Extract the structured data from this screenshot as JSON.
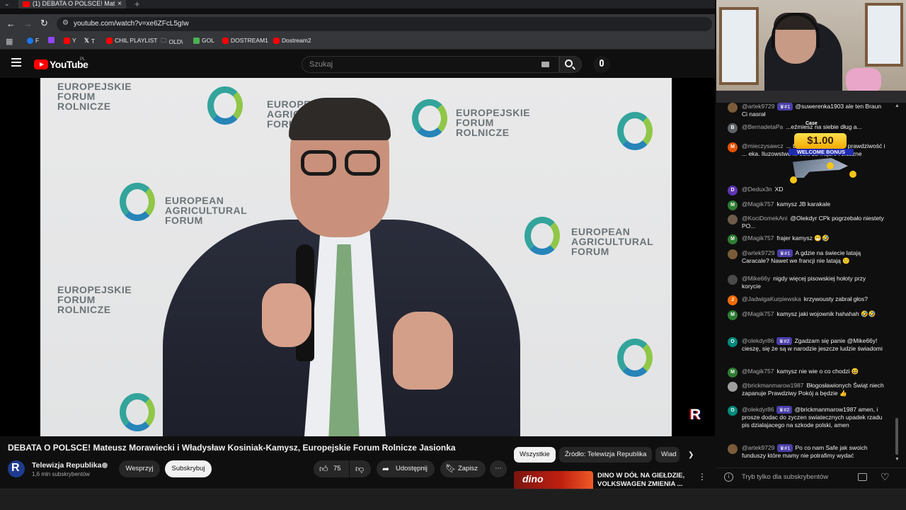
{
  "browser": {
    "tab_title": "(1) DEBATA O POLSCE! Mat",
    "url": "youtube.com/watch?v=xe6ZFcL5gIw",
    "bookmarks": [
      {
        "label": "F",
        "color": "#1877f2"
      },
      {
        "label": "",
        "color": "#9146ff"
      },
      {
        "label": "Y",
        "color": "#ff0000"
      },
      {
        "label": "T",
        "color": "#ffffff"
      },
      {
        "label": "CHIL PLAYLIST",
        "color": "#ff0000"
      },
      {
        "label": "OLD\\",
        "color": "#bdc1c6"
      },
      {
        "label": "GOL",
        "color": "#4caf50"
      },
      {
        "label": "DOSTREAM1",
        "color": "#ff0000"
      },
      {
        "label": "Dostream2",
        "color": "#ff0000"
      }
    ]
  },
  "youtube": {
    "logo_text": "YouTube",
    "region": "PL",
    "search_placeholder": "Szukaj"
  },
  "video": {
    "backdrop_texts": [
      {
        "text": "EUROPEJSKIE\nFORUM\nROLNICZE"
      },
      {
        "text": "EUROPEAN\nAGRICULTURAL\nFORUM"
      }
    ],
    "channel_bug": "R",
    "title": "DEBATA O POLSCE! Mateusz Morawiecki i Władysław Kosiniak-Kamysz, Europejskie Forum Rolnicze Jasionka",
    "channel_name": "Telewizja Republika",
    "channel_avatar": "R",
    "subscribers": "1,6 mln subskrybentów",
    "support_label": "Wesprzyj",
    "subscribe_label": "Subskrybuj",
    "likes": "75",
    "share_label": "Udostępnij",
    "save_label": "Zapisz"
  },
  "suggestions": {
    "chips": [
      "Wszystkie",
      "Źródło: Telewizja Republika",
      "Wiad"
    ],
    "thumb_text": "dino",
    "item_title": "DINO W DÓŁ NA GIEŁDZIE, VOLKSWAGEN ZMIENIA ..."
  },
  "chat": {
    "messages": [
      {
        "avatar": "",
        "avatar_color": "#7a5c3a",
        "author": "@artek9729",
        "badge": "♛#1",
        "text": "@suwerenka1903 ale ten Braun Ci nasrał"
      },
      {
        "avatar": "B",
        "avatar_color": "#5f6368",
        "author": "@BernadetaPa",
        "badge": "",
        "text": "...eźmiesz na siebie dług a..."
      },
      {
        "avatar": "M",
        "avatar_color": "#e65100",
        "author": "@mieczysawcz",
        "badge": "",
        "text": "... by powiedział Kos... prawdziwość i ... eka. Iluzowstwo ... ecki za mądre i słuszne"
      },
      {
        "avatar": "D",
        "avatar_color": "#5e35b1",
        "author": "@Dedux3n",
        "badge": "",
        "text": "XD"
      },
      {
        "avatar": "M",
        "avatar_color": "#2e7d32",
        "author": "@Magik757",
        "badge": "",
        "text": "kamysz JB karakale"
      },
      {
        "avatar": "",
        "avatar_color": "#6d5a4a",
        "author": "@KociDomekAni",
        "badge": "",
        "text": "@Olekdyr CPk pogrzebało niestety PO..."
      },
      {
        "avatar": "M",
        "avatar_color": "#2e7d32",
        "author": "@Magik757",
        "badge": "",
        "text": "frajer kamysz 😁🤣"
      },
      {
        "avatar": "",
        "avatar_color": "#7a5c3a",
        "author": "@artek9729",
        "badge": "♛#1",
        "text": "A gdzie na świecie latają Caracale? Nawet we francji nie latają 🙂"
      },
      {
        "avatar": "",
        "avatar_color": "#4a4a4a",
        "author": "@Mike66y",
        "badge": "",
        "text": "nigdy więcej pisowskiej hołoty przy korycie"
      },
      {
        "avatar": "J",
        "avatar_color": "#ef6c00",
        "author": "@JadwigaKurpiewska",
        "badge": "",
        "text": "krzywousty zabrał głos?"
      },
      {
        "avatar": "M",
        "avatar_color": "#2e7d32",
        "author": "@Magik757",
        "badge": "",
        "text": "kamysz jaki wojownik hahahah 🤣🤣"
      },
      {
        "avatar": "O",
        "avatar_color": "#00897b",
        "author": "@olekdyr86",
        "badge": "♛#2",
        "text": "Zgadzam się panie @Mike66y! cieszę, się że są w narodzie jeszcze ludzie świadomi"
      },
      {
        "avatar": "M",
        "avatar_color": "#2e7d32",
        "author": "@Magik757",
        "badge": "",
        "text": "kamysz nie wie o co chodzi 😆"
      },
      {
        "avatar": "",
        "avatar_color": "#9e9e9e",
        "author": "@brickmanmarow1987",
        "badge": "",
        "text": "Błogosławionych Świąt niech zapanuje Prawdziwy Pokój a będzie 👍"
      },
      {
        "avatar": "O",
        "avatar_color": "#00897b",
        "author": "@olekdyr86",
        "badge": "♛#2",
        "text": "@brickmanmarow1987 amen, i prosze dodac do zyczen swiatecznych upadek rzadu pis dzialajacego na szkode polski, amen"
      },
      {
        "avatar": "",
        "avatar_color": "#7a5c3a",
        "author": "@artek9729",
        "badge": "♛#1",
        "text": "Po co nam Safe jak swoich funduszy które mamy nie potrafimy wydać"
      }
    ],
    "promo": {
      "brand": "Case",
      "amount": "$1.00",
      "label": "WELCOME BONUS"
    },
    "input_placeholder": "Tryb tylko dla subskrybentów"
  }
}
